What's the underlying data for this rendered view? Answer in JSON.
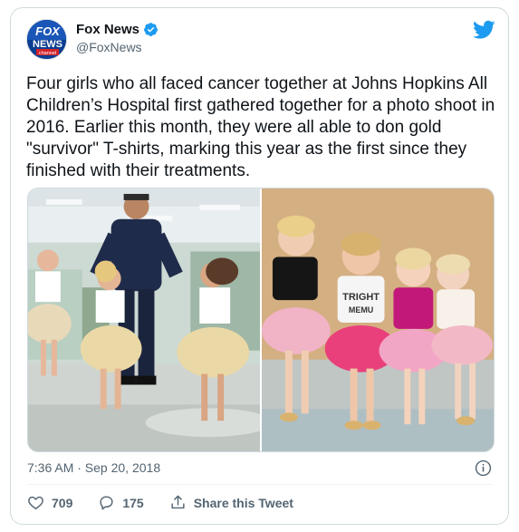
{
  "account": {
    "display_name": "Fox News",
    "handle": "@FoxNews",
    "avatar_text_top": "FOX",
    "avatar_text_mid": "NEWS",
    "avatar_text_bottom": "channel"
  },
  "tweet": {
    "text": "Four girls who all faced cancer together at Johns Hopkins All Children’s Hospital first gathered together for a photo shoot in 2016. Earlier this month, they were all able to don gold \"survivor\" T-shirts, marking this year as the first since they finished with their treatments.",
    "timestamp": "7:36 AM · Sep 20, 2018"
  },
  "media": {
    "right_photo_shirt_text_1": "TRIGHT",
    "right_photo_shirt_text_2": "MEMU"
  },
  "actions": {
    "like_count": "709",
    "reply_count": "175",
    "share_label": "Share this Tweet"
  },
  "colors": {
    "twitter_blue": "#1d9bf0",
    "text_secondary": "#536471",
    "fox_blue": "#0b3d91",
    "fox_red": "#d2232a"
  },
  "icons": [
    "verified-badge-icon",
    "twitter-bird-icon",
    "info-icon",
    "heart-icon",
    "reply-icon",
    "share-icon"
  ]
}
